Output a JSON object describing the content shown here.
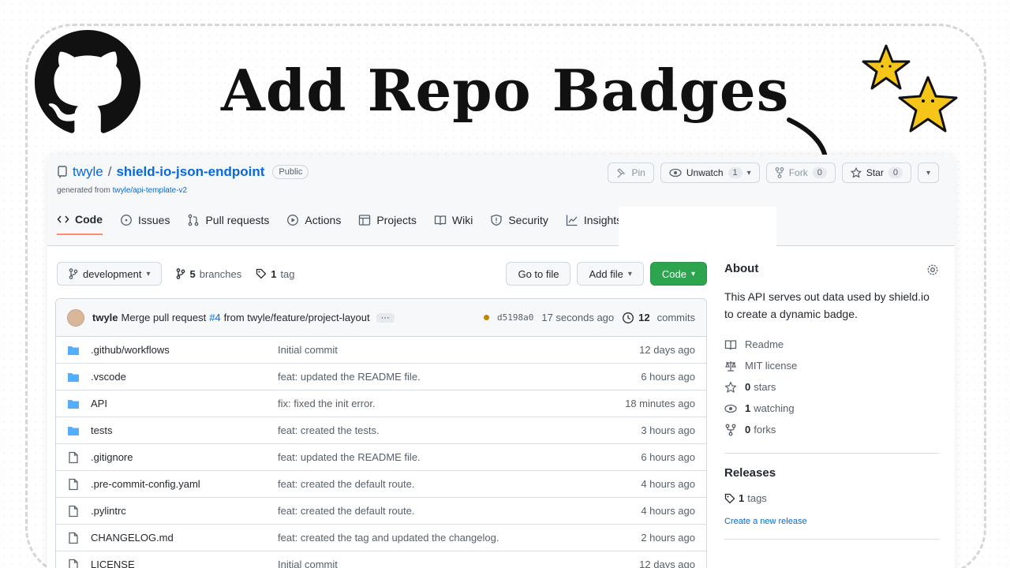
{
  "headline": "Add Repo Badges",
  "repo": {
    "owner": "twyle",
    "separator": "/",
    "name": "shield-io-json-endpoint",
    "visibility": "Public",
    "generated_prefix": "generated from",
    "generated_link": "twyle/api-template-v2"
  },
  "actions": {
    "pin": "Pin",
    "unwatch": "Unwatch",
    "unwatch_count": "1",
    "fork": "Fork",
    "fork_count": "0",
    "star": "Star",
    "star_count": "0"
  },
  "tabs": [
    {
      "label": "Code"
    },
    {
      "label": "Issues"
    },
    {
      "label": "Pull requests"
    },
    {
      "label": "Actions"
    },
    {
      "label": "Projects"
    },
    {
      "label": "Wiki"
    },
    {
      "label": "Security"
    },
    {
      "label": "Insights"
    }
  ],
  "branchbar": {
    "branch": "development",
    "branches_count": "5",
    "branches_label": "branches",
    "tags_count": "1",
    "tags_label": "tag",
    "go_to_file": "Go to file",
    "add_file": "Add file",
    "code": "Code"
  },
  "commit": {
    "author": "twyle",
    "message_prefix": "Merge pull request",
    "pr": "#4",
    "message_suffix": "from twyle/feature/project-layout",
    "ellipsis": "···",
    "sha": "d5198a0",
    "time": "17 seconds ago",
    "commits_count": "12",
    "commits_label": "commits"
  },
  "files": [
    {
      "type": "dir",
      "name": ".github/workflows",
      "message": "Initial commit",
      "age": "12 days ago"
    },
    {
      "type": "dir",
      "name": ".vscode",
      "message": "feat: updated the README file.",
      "age": "6 hours ago"
    },
    {
      "type": "dir",
      "name": "API",
      "message": "fix: fixed the init error.",
      "age": "18 minutes ago"
    },
    {
      "type": "dir",
      "name": "tests",
      "message": "feat: created the tests.",
      "age": "3 hours ago"
    },
    {
      "type": "file",
      "name": ".gitignore",
      "message": "feat: updated the README file.",
      "age": "6 hours ago"
    },
    {
      "type": "file",
      "name": ".pre-commit-config.yaml",
      "message": "feat: created the default route.",
      "age": "4 hours ago"
    },
    {
      "type": "file",
      "name": ".pylintrc",
      "message": "feat: created the default route.",
      "age": "4 hours ago"
    },
    {
      "type": "file",
      "name": "CHANGELOG.md",
      "message": "feat: created the tag and updated the changelog.",
      "age": "2 hours ago"
    },
    {
      "type": "file",
      "name": "LICENSE",
      "message": "Initial commit",
      "age": "12 days ago"
    }
  ],
  "about": {
    "title": "About",
    "description": "This API serves out data used by shield.io to create a dynamic badge.",
    "readme": "Readme",
    "license": "MIT license",
    "stars_count": "0",
    "stars_label": "stars",
    "watching_count": "1",
    "watching_label": "watching",
    "forks_count": "0",
    "forks_label": "forks"
  },
  "releases": {
    "title": "Releases",
    "tags_count": "1",
    "tags_label": "tags",
    "create_link": "Create a new release"
  },
  "colors": {
    "link": "#0969da",
    "code_button": "#2da44e",
    "active_tab_underline": "#fd8c73",
    "star_yellow": "#f5c518"
  }
}
